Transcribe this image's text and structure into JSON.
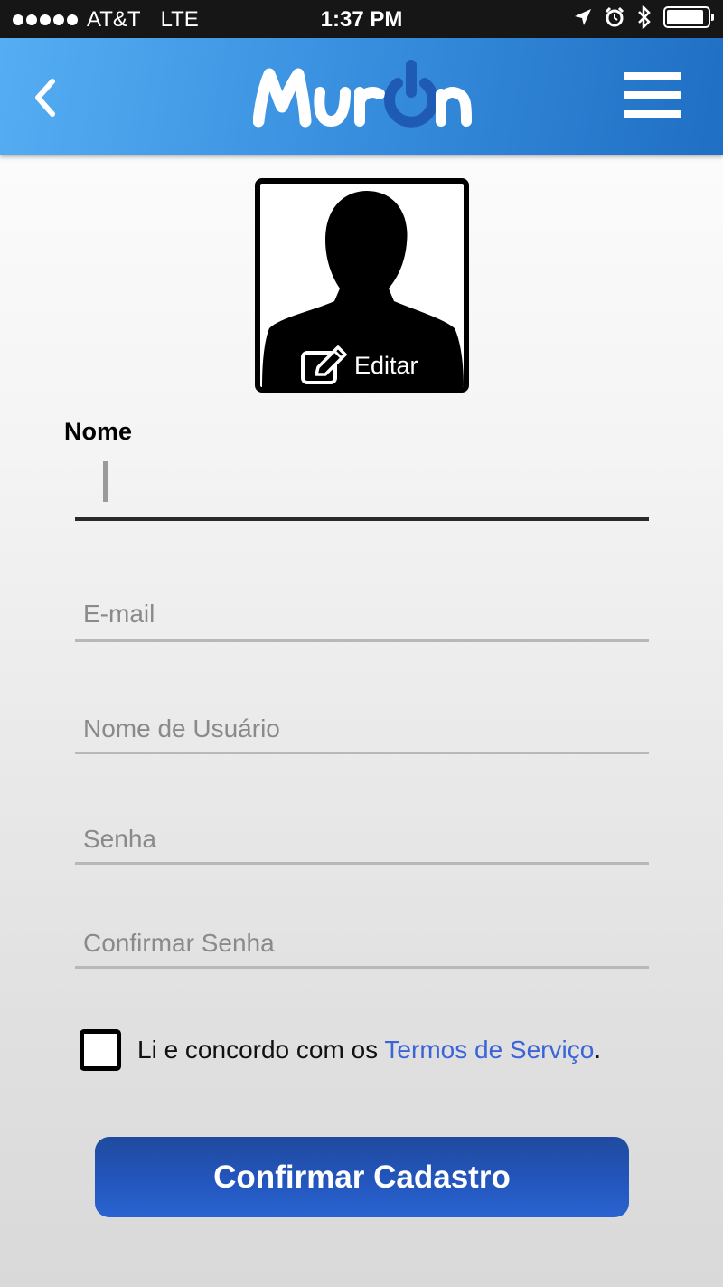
{
  "status_bar": {
    "carrier": "AT&T",
    "network": "LTE",
    "time": "1:37 PM",
    "signal_bars": 5,
    "battery_level": 0.9,
    "icons": [
      "location-arrow-icon",
      "alarm-icon",
      "bluetooth-icon",
      "battery-icon"
    ]
  },
  "header": {
    "brand": "MurOn",
    "icons": [
      "back-chevron-icon",
      "hamburger-menu-icon"
    ],
    "colors": {
      "gradient_start": "#55aef3",
      "gradient_end": "#1f6fc4",
      "logo_accent": "#1f5bb5"
    }
  },
  "profile_photo": {
    "edit_label": "Editar",
    "icons": [
      "person-silhouette-icon",
      "edit-pencil-icon"
    ]
  },
  "form": {
    "name_label": "Nome",
    "name_value": "",
    "email_placeholder": "E-mail",
    "username_placeholder": "Nome de Usuário",
    "password_placeholder": "Senha",
    "confirm_password_placeholder": "Confirmar Senha"
  },
  "terms": {
    "checked": false,
    "text_before": "Li e concordo com os ",
    "link_text": "Termos de Serviço",
    "text_after": ".",
    "link_color": "#3a64d8"
  },
  "confirm_button": {
    "label": "Confirmar Cadastro",
    "color": "#2356bd"
  }
}
